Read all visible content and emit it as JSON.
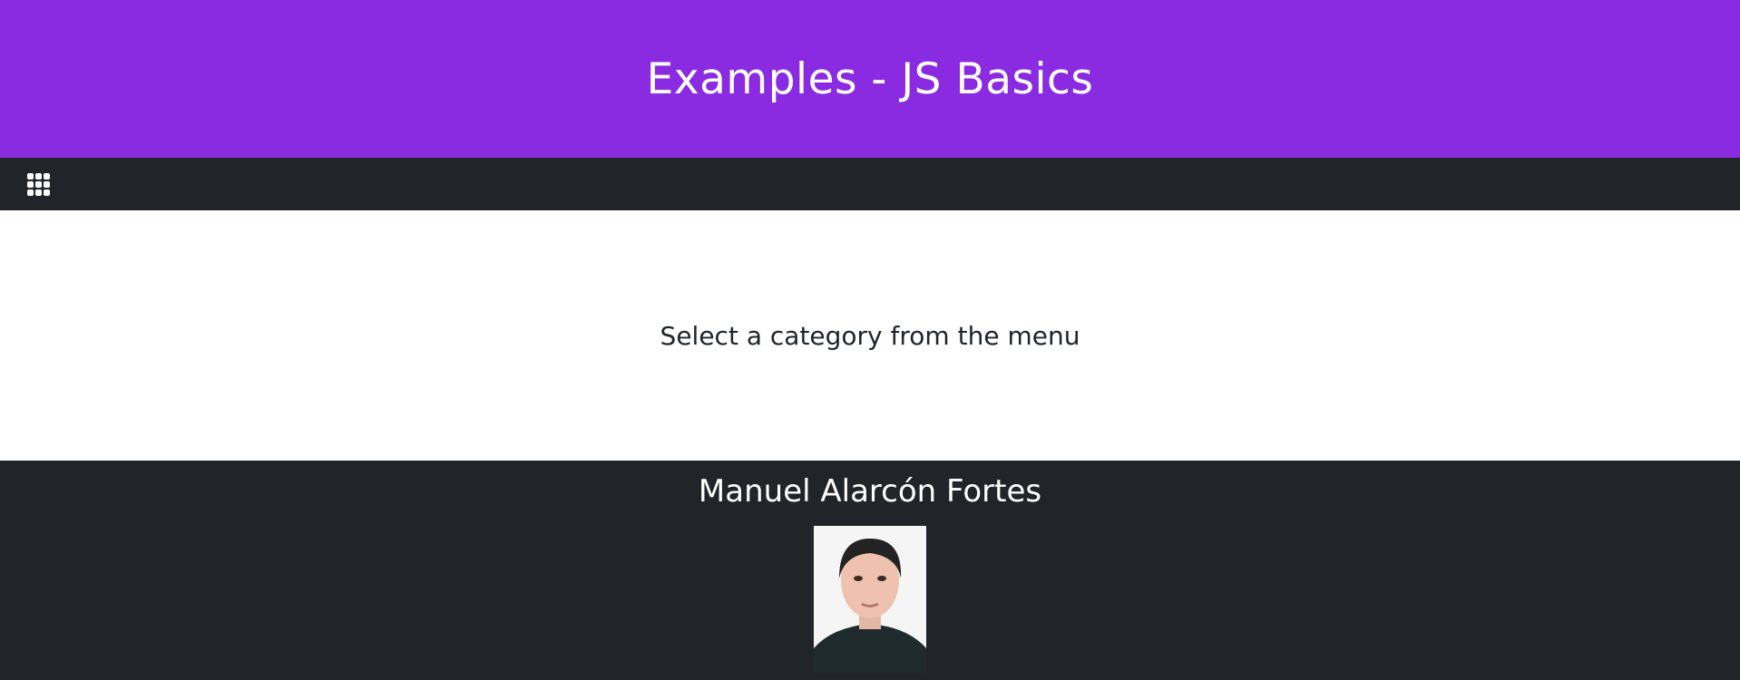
{
  "header": {
    "title": "Examples - JS Basics"
  },
  "navbar": {
    "menu_icon": "grid-menu-icon"
  },
  "main": {
    "message": "Select a category from the menu"
  },
  "footer": {
    "author_name": "Manuel Alarcón Fortes",
    "photo_icon": "author-photo"
  },
  "colors": {
    "header_bg": "#8a2be2",
    "navbar_bg": "#212529",
    "footer_bg": "#212529",
    "main_bg": "#ffffff",
    "text_dark": "#212529",
    "text_light": "#ffffff"
  }
}
